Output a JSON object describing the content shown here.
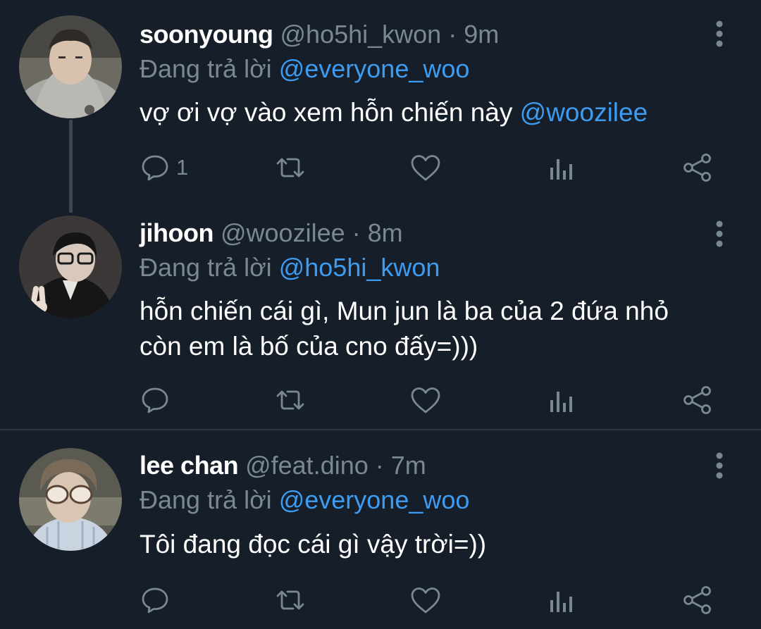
{
  "colors": {
    "background": "#151e29",
    "primary_text": "#ffffff",
    "secondary_text": "#7a8896",
    "accent_link": "#3d9bf0",
    "thread_line": "#3a4654"
  },
  "tweets": [
    {
      "name": "soonyoung",
      "handle": "@ho5hi_kwon",
      "separator": "·",
      "time": "9m",
      "reply_prefix": "Đang trả lời",
      "reply_to": "@everyone_woo",
      "text_parts": [
        "vợ ơi vợ vào xem hỗn chiến này ",
        "@woozilee"
      ],
      "reply_count": "1"
    },
    {
      "name": "jihoon",
      "handle": "@woozilee",
      "separator": "·",
      "time": "8m",
      "reply_prefix": "Đang trả lời",
      "reply_to": "@ho5hi_kwon",
      "text_lines": [
        "hỗn chiến cái gì, Mun jun là ba của 2 đứa nhỏ",
        "còn em là bố của cno đấy=)))"
      ]
    },
    {
      "name": "lee chan",
      "handle": "@feat.dino",
      "separator": "·",
      "time": "7m",
      "reply_prefix": "Đang trả lời",
      "reply_to": "@everyone_woo",
      "text": "Tôi đang đọc cái gì vậy trời=))"
    }
  ],
  "icons": {
    "reply": "reply-bubble-icon",
    "retweet": "retweet-icon",
    "like": "heart-icon",
    "analytics": "analytics-bars-icon",
    "share": "share-icon",
    "more": "vertical-dots-icon"
  }
}
